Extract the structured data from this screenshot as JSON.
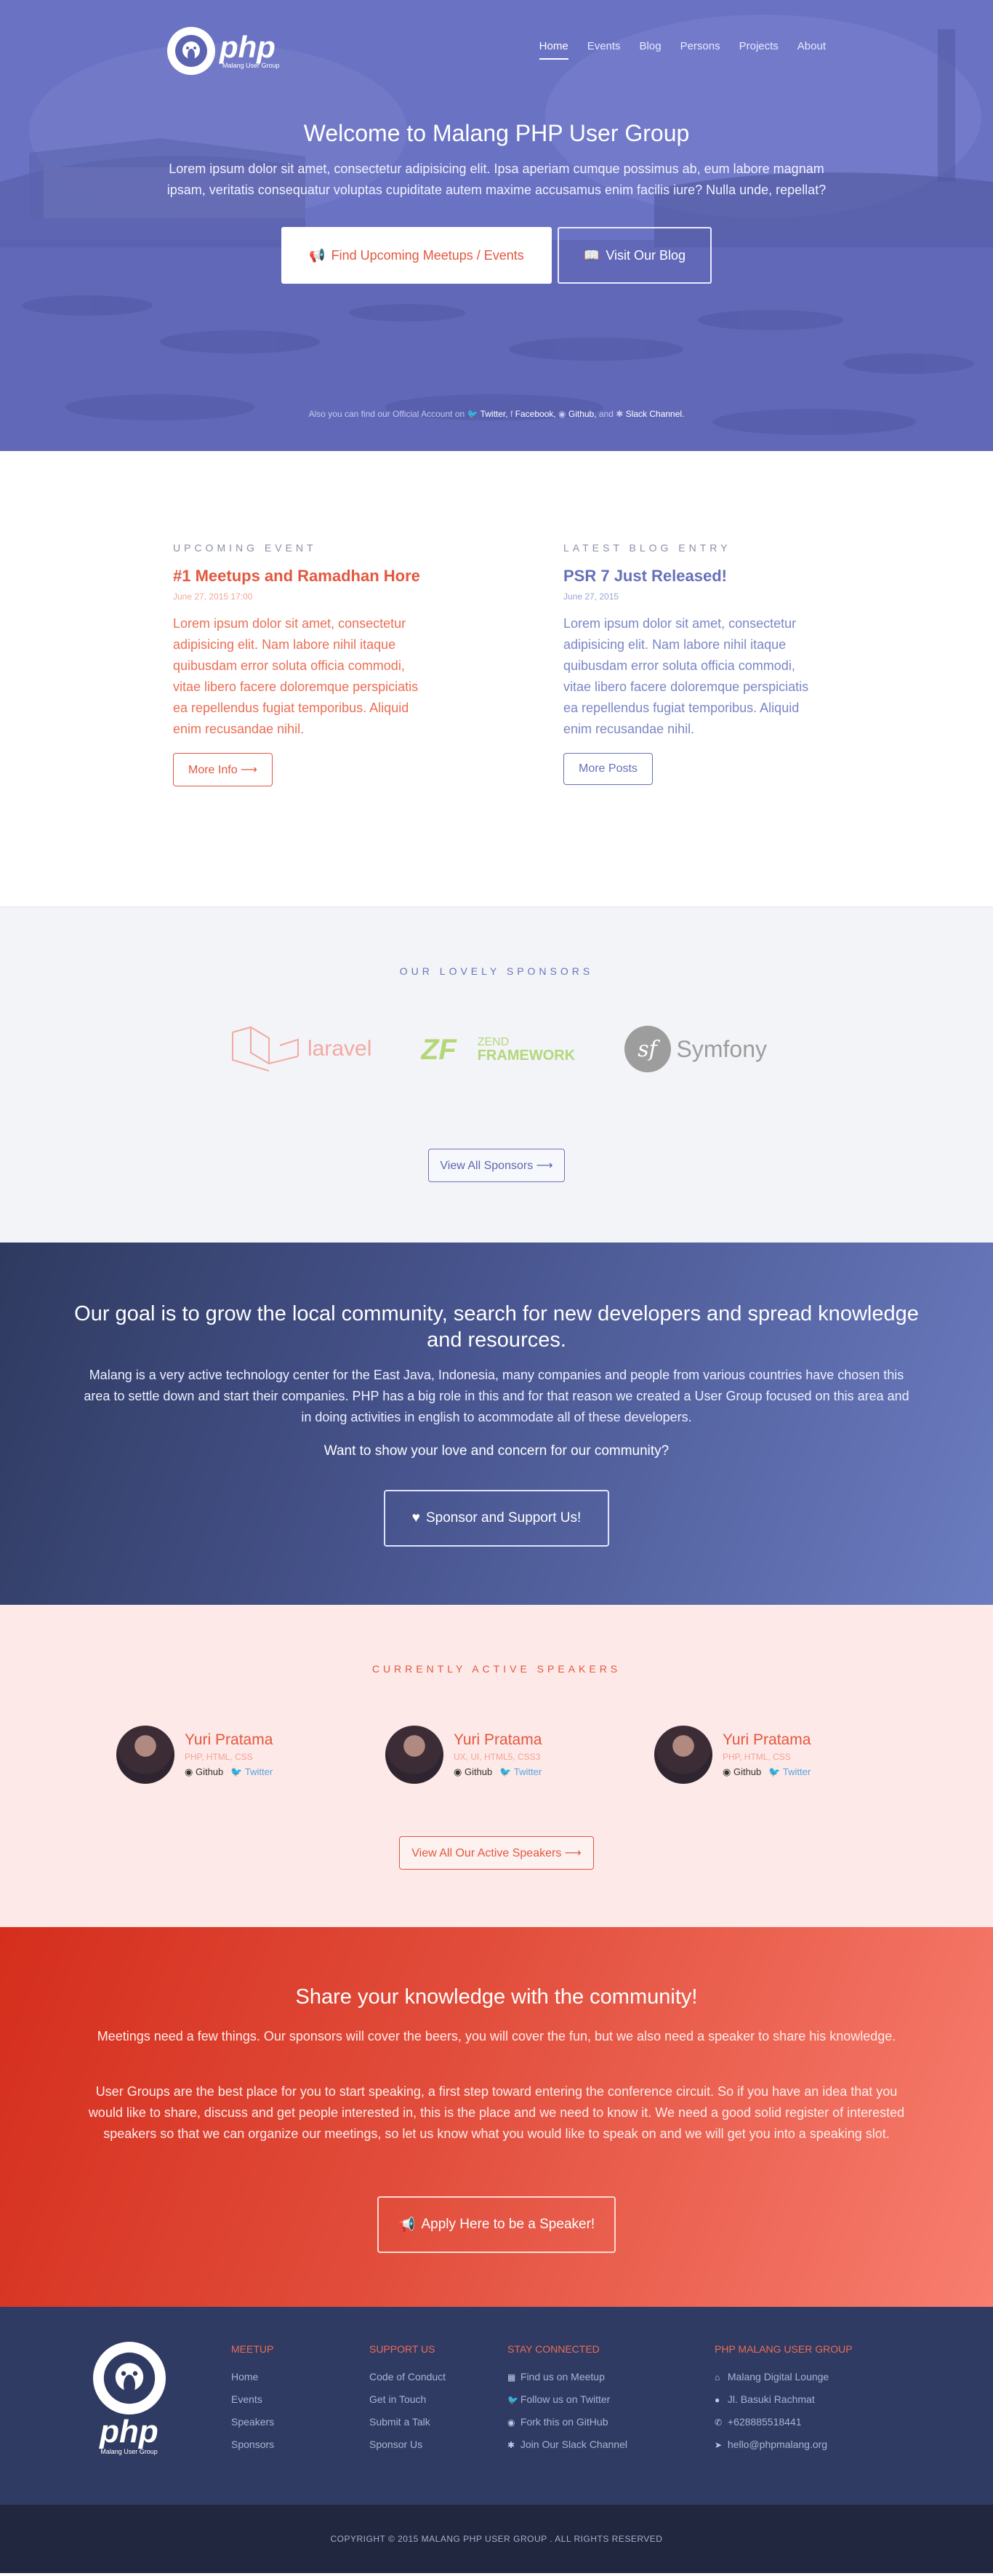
{
  "nav": {
    "brand_big": "php",
    "brand_small": "Malang User Group",
    "items": [
      "Home",
      "Events",
      "Blog",
      "Persons",
      "Projects",
      "About"
    ],
    "active": "Home"
  },
  "hero": {
    "title": "Welcome to Malang PHP User Group",
    "text": "Lorem ipsum dolor sit amet, consectetur adipisicing elit. Ipsa aperiam cumque possimus ab, eum labore magnam ipsam, veritatis consequatur voluptas cupiditate autem maxime accusamus enim facilis iure? Nulla unde, repellat?",
    "primary_button": "Find Upcoming Meetups / Events",
    "secondary_button": "Visit Our Blog",
    "social_prefix": "Also you can find our Official Account on",
    "social_twitter": "Twitter,",
    "social_facebook": "Facebook,",
    "social_github": "Github,",
    "social_and": "and",
    "social_slack": "Slack Channel."
  },
  "upcoming": {
    "kicker": "Upcoming Event",
    "title": "#1 Meetups and Ramadhan Hore",
    "date": "June 27, 2015 17:00",
    "body": "Lorem ipsum dolor sit amet, consectetur adipisicing elit. Nam labore nihil itaque quibusdam error soluta officia commodi, vitae libero facere doloremque perspiciatis ea repellendus fugiat temporibus. Aliquid enim recusandae nihil.",
    "button": "More Info ⟶"
  },
  "blog": {
    "kicker": "Latest Blog Entry",
    "title": "PSR 7 Just Released!",
    "date": "June 27, 2015",
    "body": "Lorem ipsum dolor sit amet, consectetur adipisicing elit. Nam labore nihil itaque quibusdam error soluta officia commodi, vitae libero facere doloremque perspiciatis ea repellendus fugiat temporibus. Aliquid enim recusandae nihil.",
    "button": "More Posts"
  },
  "sponsors": {
    "title": "OUR LOVELY SPONSORS",
    "laravel": "laravel",
    "zend_line1": "ZEND",
    "zend_line2": "FRAMEWORK",
    "symfony": "Symfony",
    "button": "View All Sponsors ⟶"
  },
  "goal": {
    "title": "Our goal is to grow the local community, search for new developers and spread knowledge and resources.",
    "text": "Malang is a very active technology center for the East Java, Indonesia, many companies and people from various countries have chosen this area to settle down and start their companies. PHP has a big role in this and for that reason we created a User Group focused on this area and in doing activities in english to acommodate all of these developers.",
    "ask": "Want to show your love and concern for our community?",
    "button": "Sponsor and Support Us!"
  },
  "speakers": {
    "title": "CURRENTLY ACTIVE SPEAKERS",
    "list": [
      {
        "name": "Yuri Pratama",
        "skills": "PHP, HTML, CSS",
        "github": "Github",
        "twitter": "Twitter"
      },
      {
        "name": "Yuri Pratama",
        "skills": "UX, UI, HTML5, CSS3",
        "github": "Github",
        "twitter": "Twitter"
      },
      {
        "name": "Yuri Pratama",
        "skills": "PHP, HTML, CSS",
        "github": "Github",
        "twitter": "Twitter"
      }
    ],
    "button": "View All Our Active Speakers ⟶"
  },
  "share": {
    "title": "Share your knowledge with the community!",
    "text1": "Meetings need a few things. Our sponsors will cover the beers, you will cover the fun, but we also need a speaker to share his knowledge.",
    "text2": "User Groups are the best place for you to start speaking, a first step toward entering the conference circuit. So if you have an idea that you would like to share, discuss and get people interested in, this is the place and we need to know it. We need a good solid register of interested speakers so that we can organize our meetings, so let us know what you would like to speak on and we will get you into a speaking slot.",
    "button": "Apply Here to be a Speaker!"
  },
  "footer": {
    "brand_big": "php",
    "brand_small": "Malang User Group",
    "meetup": {
      "title": "MEETUP",
      "links": [
        "Home",
        "Events",
        "Speakers",
        "Sponsors"
      ]
    },
    "support": {
      "title": "SUPPORT US",
      "links": [
        "Code of Conduct",
        "Get in Touch",
        "Submit a Talk",
        "Sponsor Us"
      ]
    },
    "connected": {
      "title": "STAY CONNECTED",
      "links": [
        "Find us on Meetup",
        "Follow us on Twitter",
        "Fork this on GitHub",
        "Join Our Slack Channel"
      ]
    },
    "group": {
      "title": "PHP MALANG USER GROUP",
      "links": [
        "Malang Digital Lounge",
        "Jl. Basuki Rachmat",
        "+628885518441",
        "hello@phpmalang.org"
      ]
    },
    "copyright": "COPYRIGHT © 2015 MALANG PHP USER GROUP . ALL RIGHTS RESERVED"
  },
  "colors": {
    "accent_red": "#e3573f",
    "accent_blue": "#6571b8",
    "footer_bg": "#2f3b62"
  }
}
